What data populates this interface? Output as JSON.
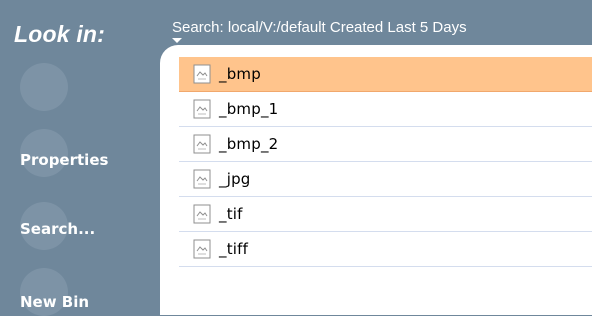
{
  "sidebar": {
    "look_in": "Look in:",
    "items": [
      {
        "label": ""
      },
      {
        "label": "Properties"
      },
      {
        "label": "Search..."
      },
      {
        "label": "New Bin"
      }
    ]
  },
  "search": {
    "text": "Search: local/V:/default Created Last 5 Days"
  },
  "list": {
    "items": [
      {
        "label": "_bmp"
      },
      {
        "label": "_bmp_1"
      },
      {
        "label": "_bmp_2"
      },
      {
        "label": "_jpg"
      },
      {
        "label": "_tif"
      },
      {
        "label": "_tiff"
      }
    ],
    "selected_index": 0
  },
  "colors": {
    "sidebar_bg": "#6f879b",
    "panel_bg": "#ffffff",
    "selected_bg": "#ffc48c",
    "row_divider": "#d4ddee"
  },
  "icons": {
    "file": "image-file-icon"
  }
}
